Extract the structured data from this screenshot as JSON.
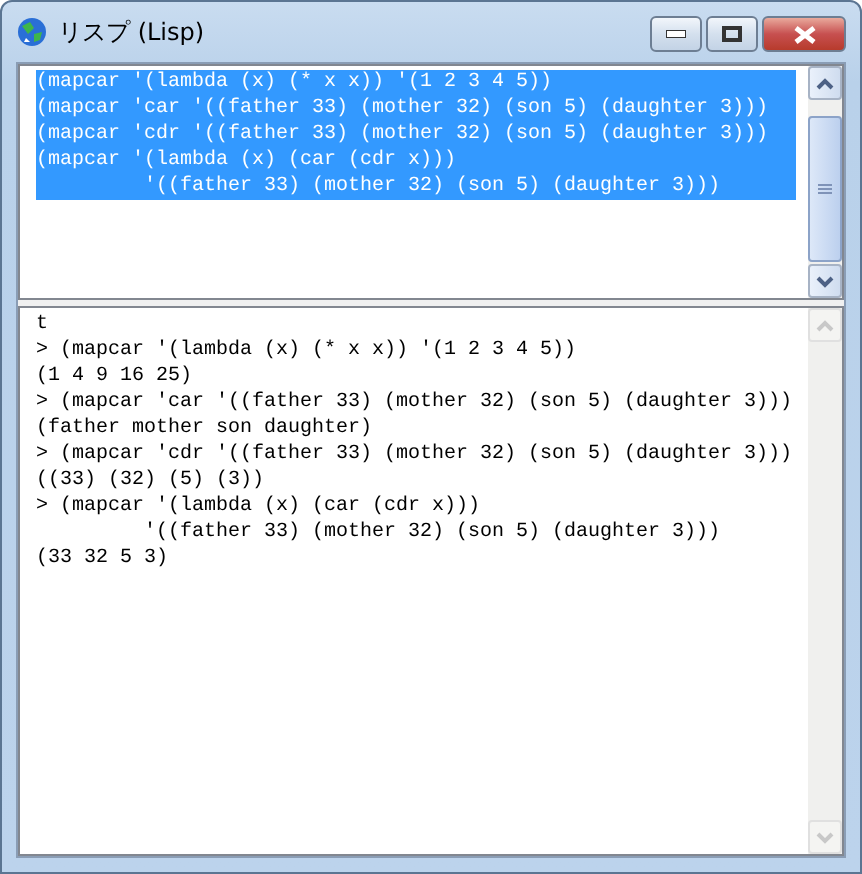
{
  "window": {
    "title": "リスプ (Lisp)"
  },
  "editor": {
    "lines": [
      {
        "text": "(mapcar '(lambda (x) (* x x)) '(1 2 3 4 5))",
        "selected": true
      },
      {
        "text": "(mapcar 'car '((father 33) (mother 32) (son 5) (daughter 3)))",
        "selected": true
      },
      {
        "text": "(mapcar 'cdr '((father 33) (mother 32) (son 5) (daughter 3)))",
        "selected": true
      },
      {
        "text": "(mapcar '(lambda (x) (car (cdr x)))",
        "selected": true
      },
      {
        "text": "         '((father 33) (mother 32) (son 5) (daughter 3)))",
        "selected": true
      }
    ]
  },
  "console": {
    "lines": [
      "t",
      "> (mapcar '(lambda (x) (* x x)) '(1 2 3 4 5))",
      "(1 4 9 16 25)",
      "> (mapcar 'car '((father 33) (mother 32) (son 5) (daughter 3)))",
      "(father mother son daughter)",
      "> (mapcar 'cdr '((father 33) (mother 32) (son 5) (daughter 3)))",
      "((33) (32) (5) (3))",
      "> (mapcar '(lambda (x) (car (cdr x)))",
      "         '((father 33) (mother 32) (son 5) (daughter 3)))",
      "(33 32 5 3)"
    ]
  }
}
